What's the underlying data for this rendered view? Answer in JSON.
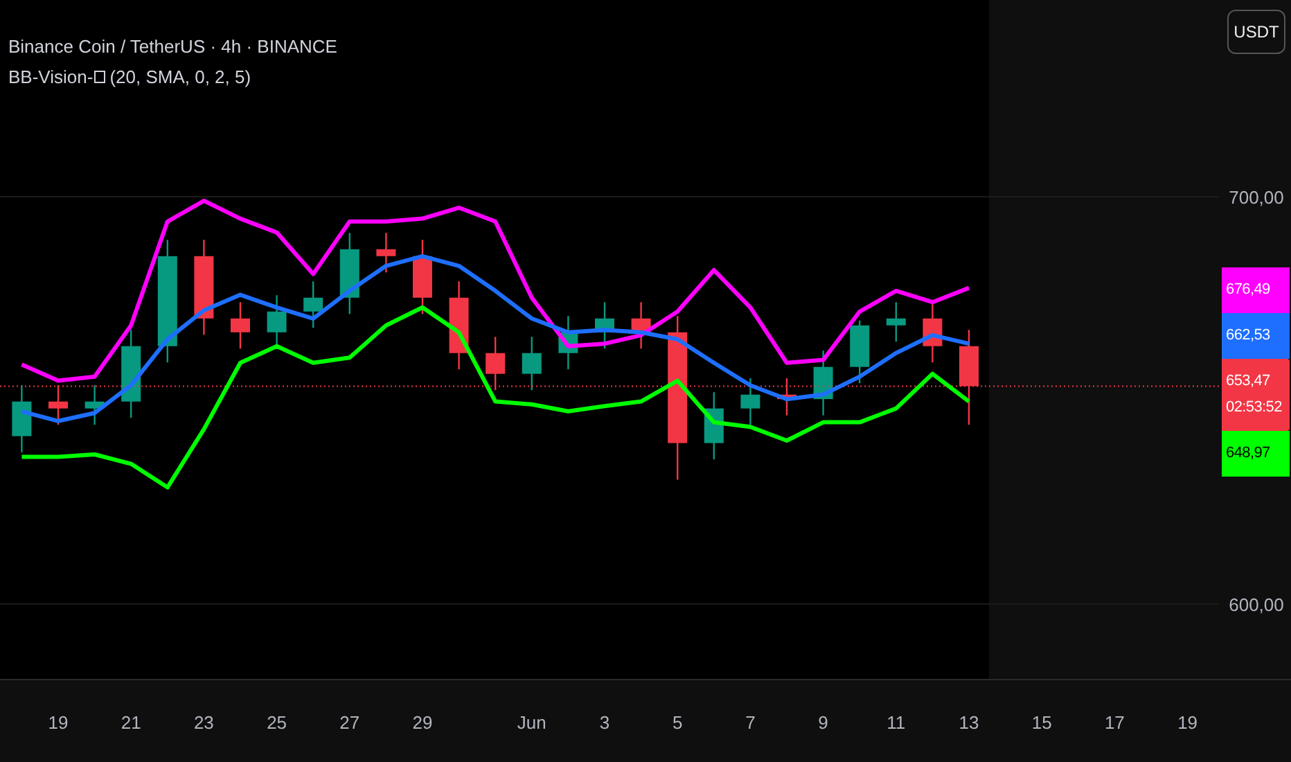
{
  "legend": {
    "symbol_line": "Binance Coin / TetherUS · 4h · BINANCE",
    "indicator_name": "BB-Vision-",
    "indicator_params": "(20, SMA, 0, 2, 5)"
  },
  "currency_button": "USDT",
  "chart": {
    "chart_data": {
      "type": "candlestick",
      "categories": [
        null,
        "19",
        null,
        "21",
        null,
        "23",
        null,
        "25",
        null,
        "27",
        null,
        "29",
        null,
        null,
        "Jun",
        null,
        "3",
        null,
        "5",
        null,
        "7",
        null,
        "9",
        null,
        "11",
        null,
        "13",
        null,
        "15",
        null,
        "17",
        null,
        "19"
      ],
      "ohlc": [
        [
          641.2,
          653.7,
          637.2,
          649.7
        ],
        [
          649.7,
          653.7,
          644.0,
          648.0
        ],
        [
          648.0,
          653.7,
          644.0,
          649.7
        ],
        [
          649.7,
          667.3,
          645.7,
          663.3
        ],
        [
          663.3,
          689.4,
          659.3,
          685.4
        ],
        [
          685.4,
          689.4,
          666.1,
          670.1
        ],
        [
          670.1,
          674.1,
          662.7,
          666.7
        ],
        [
          666.7,
          675.8,
          662.7,
          671.8
        ],
        [
          671.8,
          679.2,
          667.8,
          675.2
        ],
        [
          675.2,
          691.1,
          671.2,
          687.1
        ],
        [
          687.1,
          691.1,
          681.4,
          685.4
        ],
        [
          685.4,
          689.4,
          671.2,
          675.2
        ],
        [
          675.2,
          679.2,
          657.6,
          661.6
        ],
        [
          661.6,
          665.6,
          652.5,
          656.5
        ],
        [
          656.5,
          665.6,
          652.5,
          661.6
        ],
        [
          661.6,
          670.7,
          657.6,
          666.7
        ],
        [
          666.7,
          674.1,
          662.7,
          670.1
        ],
        [
          670.1,
          674.1,
          662.7,
          666.7
        ],
        [
          666.7,
          670.7,
          630.5,
          639.5
        ],
        [
          639.5,
          652.0,
          635.5,
          648.0
        ],
        [
          648.0,
          655.4,
          644.0,
          651.4
        ],
        [
          651.4,
          655.4,
          646.3,
          650.3
        ],
        [
          650.3,
          662.2,
          646.3,
          658.2
        ],
        [
          658.2,
          669.6,
          654.2,
          668.4
        ],
        [
          668.4,
          674.1,
          664.4,
          670.1
        ],
        [
          670.1,
          674.1,
          659.3,
          663.3
        ],
        [
          663.3,
          667.3,
          644.0,
          653.47
        ],
        null,
        null,
        null,
        null,
        null,
        null
      ],
      "ylim": [
        581.6,
        748.3
      ],
      "yticks": [
        {
          "value": 600,
          "label": "600,00"
        },
        {
          "value": 700,
          "label": "700,00"
        }
      ]
    }
  },
  "bands": {
    "chart_data": {
      "type": "line",
      "ylim": [
        581.6,
        748.3
      ],
      "series": [
        {
          "color": "#ff00ff",
          "values": [
            658.8,
            654.8,
            655.8,
            668.4,
            693.9,
            699.0,
            694.6,
            691.2,
            681.0,
            693.9,
            693.9,
            694.6,
            697.3,
            693.9,
            675.2,
            663.3,
            663.9,
            666.0,
            671.8,
            682.0,
            672.8,
            659.2,
            659.9,
            671.8,
            676.9,
            674.1,
            677.6,
            null,
            null,
            null,
            null,
            null,
            null
          ]
        },
        {
          "color": "#1e6fff",
          "values": [
            647.3,
            644.9,
            646.9,
            653.7,
            665.0,
            672.1,
            675.9,
            672.8,
            670.1,
            676.9,
            683.0,
            685.4,
            683.0,
            676.9,
            670.1,
            666.7,
            667.3,
            666.7,
            665.0,
            659.2,
            653.7,
            650.3,
            651.4,
            655.8,
            661.6,
            666.0,
            663.9,
            null,
            null,
            null,
            null,
            null,
            null
          ]
        },
        {
          "color": "#00ff00",
          "values": [
            636.1,
            636.1,
            636.7,
            634.4,
            628.6,
            642.9,
            659.2,
            663.3,
            659.2,
            660.5,
            668.4,
            672.8,
            666.7,
            649.7,
            649.0,
            647.3,
            648.6,
            649.7,
            654.8,
            644.6,
            643.5,
            640.1,
            644.6,
            644.6,
            648.0,
            656.5,
            649.7,
            null,
            null,
            null,
            null,
            null,
            null
          ]
        }
      ]
    }
  },
  "price_tags": [
    {
      "kind": "value",
      "value": "676,49",
      "color": "#ff00ff"
    },
    {
      "kind": "value",
      "value": "662,53",
      "color": "#1e6fff"
    },
    {
      "kind": "current",
      "value": "653,47",
      "countdown": "02:53:52",
      "color": "#f23645"
    },
    {
      "kind": "value",
      "value": "648,97",
      "color": "#00ff00"
    }
  ]
}
